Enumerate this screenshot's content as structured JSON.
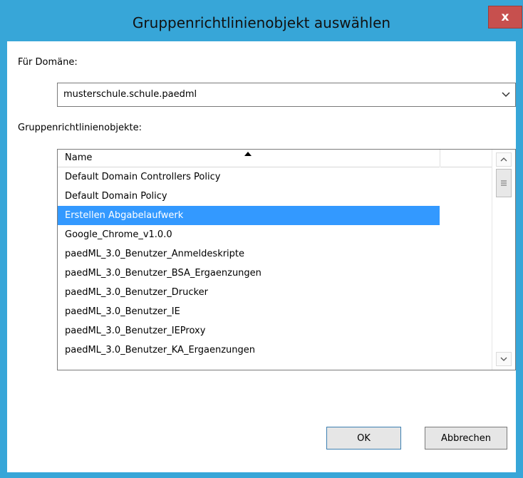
{
  "window": {
    "title": "Gruppenrichtlinienobjekt auswählen",
    "close_label": "x"
  },
  "domain_label": "Für Domäne:",
  "domain_value": "musterschule.schule.paedml",
  "gpo_list_label": "Gruppenrichtlinienobjekte:",
  "list": {
    "column_name": "Name",
    "sorted_column": "Name",
    "sort_direction": "ascending",
    "selected_index": 2,
    "items": [
      "Default Domain Controllers Policy",
      "Default Domain Policy",
      "Erstellen Abgabelaufwerk",
      "Google_Chrome_v1.0.0",
      "paedML_3.0_Benutzer_Anmeldeskripte",
      "paedML_3.0_Benutzer_BSA_Ergaenzungen",
      "paedML_3.0_Benutzer_Drucker",
      "paedML_3.0_Benutzer_IE",
      "paedML_3.0_Benutzer_IEProxy",
      "paedML_3.0_Benutzer_KA_Ergaenzungen"
    ]
  },
  "buttons": {
    "ok": "OK",
    "cancel": "Abbrechen"
  },
  "colors": {
    "frame": "#37a6d8",
    "selection": "#3399ff",
    "close": "#c7504e"
  }
}
